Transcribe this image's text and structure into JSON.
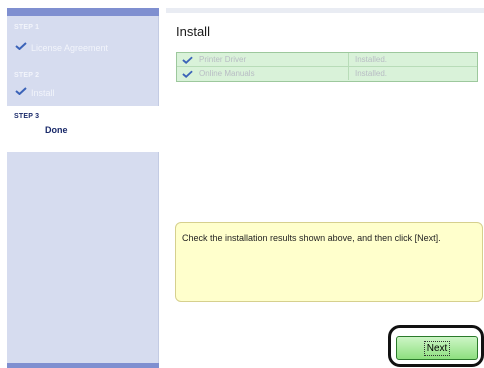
{
  "sidebar": {
    "steps": [
      {
        "label": "STEP 1",
        "title": "License Agreement",
        "state": "done"
      },
      {
        "label": "STEP 2",
        "title": "Install",
        "state": "done"
      },
      {
        "label": "STEP 3",
        "title": "Done",
        "state": "current"
      }
    ]
  },
  "main": {
    "title": "Install",
    "results": [
      {
        "name": "Printer Driver",
        "status": "Installed."
      },
      {
        "name": "Online Manuals",
        "status": "Installed."
      }
    ],
    "message": "Check the installation results shown above, and then click [Next].",
    "next_label": "Next"
  },
  "icons": {
    "check": "checkmark-icon"
  },
  "colors": {
    "sidebar_bg": "#d6dcef",
    "sidebar_accent": "#7f8fd0",
    "results_bg": "#d9f2d9",
    "message_bg": "#ffffcc",
    "button_green": "#8ee07f",
    "check_blue": "#3b63b8"
  }
}
